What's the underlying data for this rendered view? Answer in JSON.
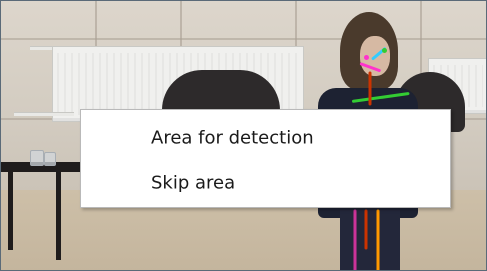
{
  "context_menu": {
    "items": [
      {
        "label": "Area for detection"
      },
      {
        "label": "Skip area"
      }
    ]
  },
  "scene": {
    "skeleton_colors": {
      "head": "#ff33cc",
      "neck": "#33ccff",
      "shoulder": "#33cc33",
      "torso": "#cc3300",
      "left_leg": "#cc3399",
      "right_leg": "#ff9900",
      "spine": "#ffcc00"
    },
    "icons": [
      "video-frame",
      "skeleton-overlay"
    ]
  }
}
